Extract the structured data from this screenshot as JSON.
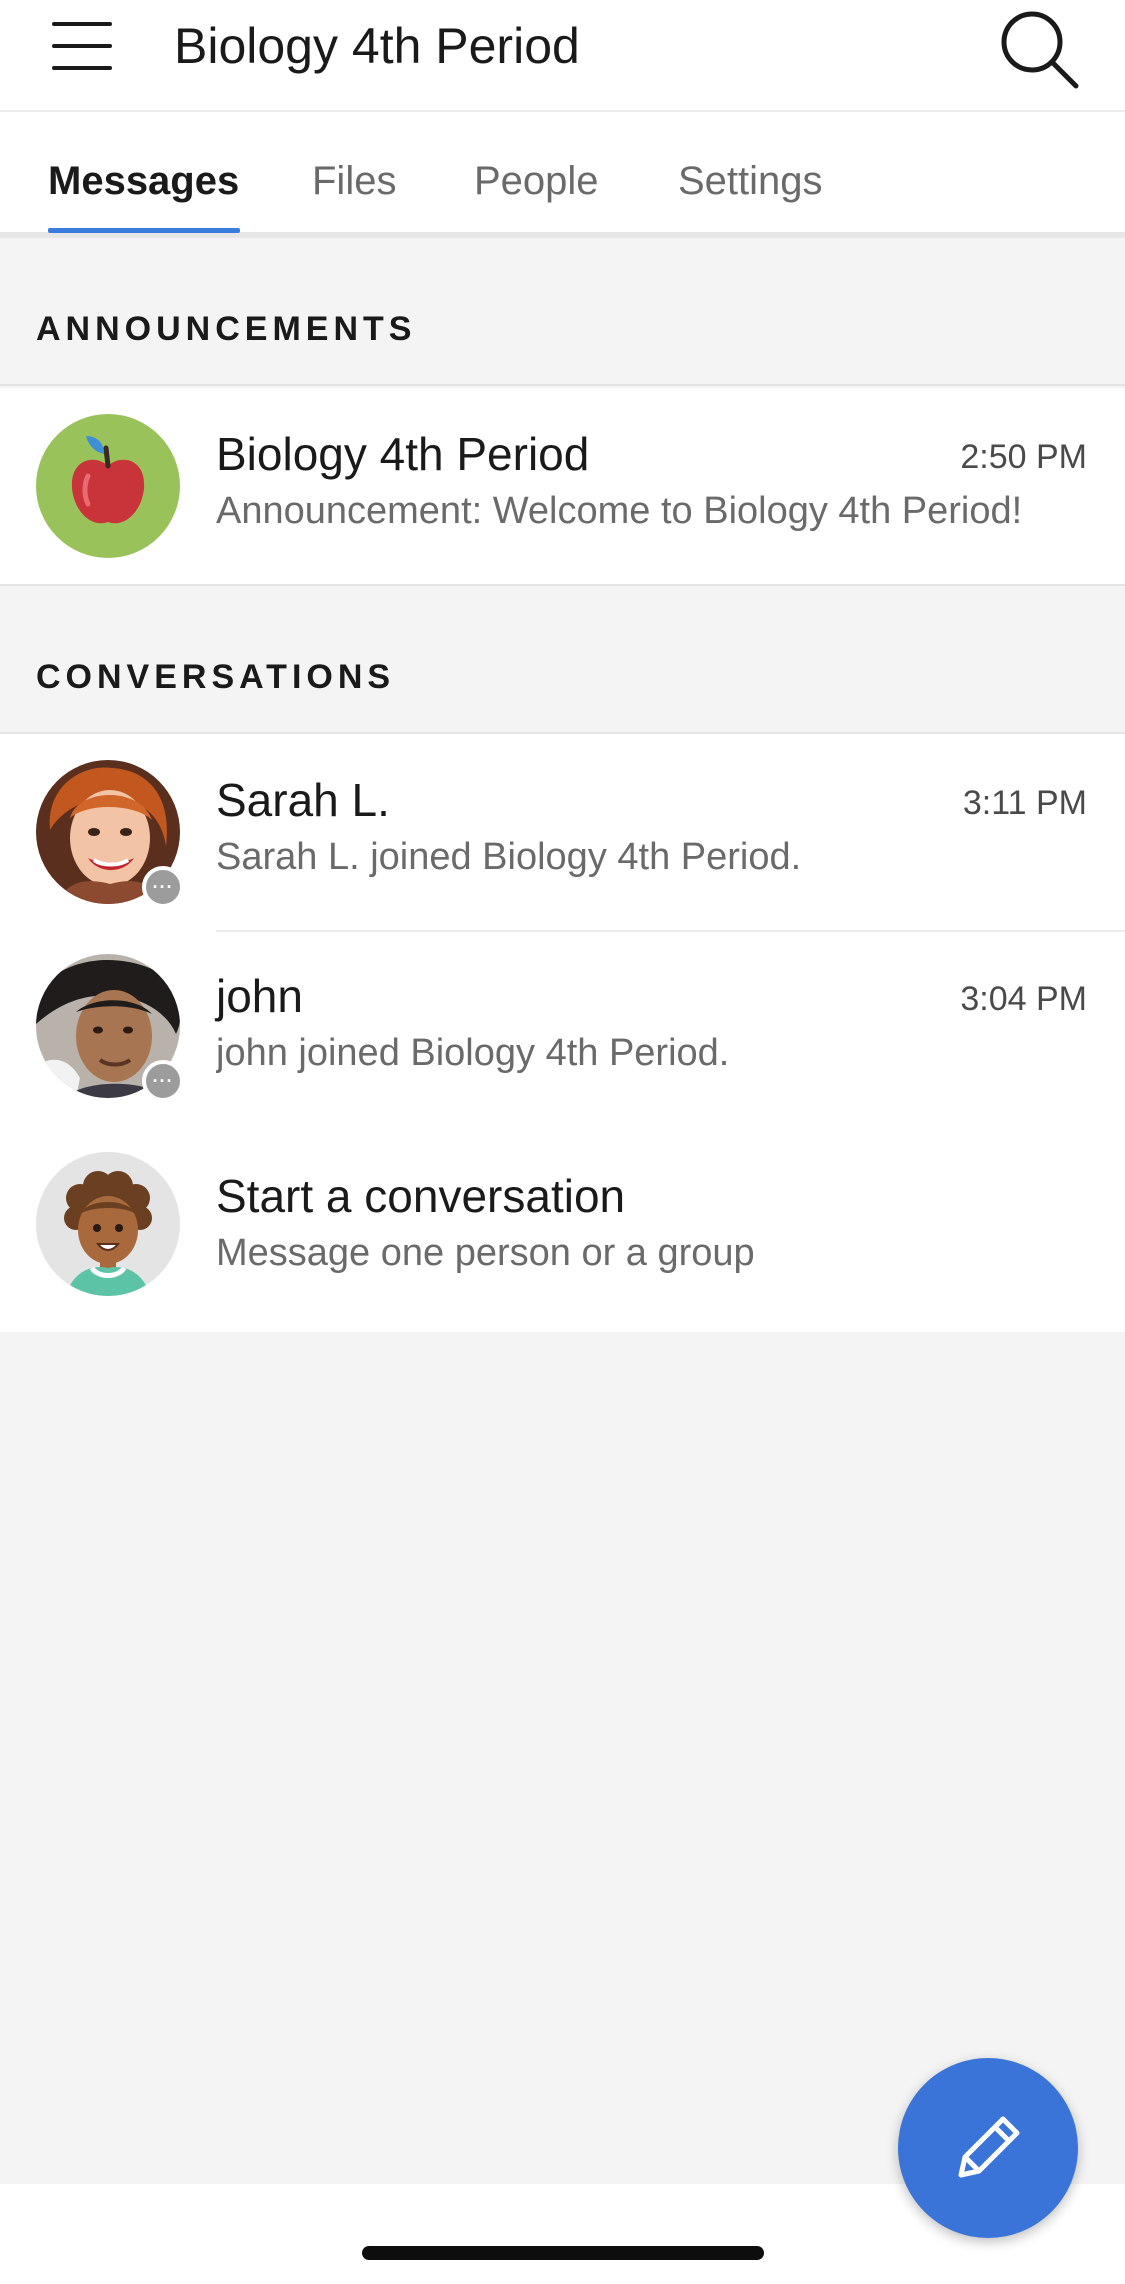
{
  "header": {
    "title": "Biology 4th Period",
    "menu_icon": "hamburger-menu-icon",
    "search_icon": "search-icon"
  },
  "tabs": [
    {
      "label": "Messages",
      "active": true
    },
    {
      "label": "Files",
      "active": false
    },
    {
      "label": "People",
      "active": false
    },
    {
      "label": "Settings",
      "active": false
    }
  ],
  "announcements": {
    "header": "ANNOUNCEMENTS",
    "items": [
      {
        "name": "Biology 4th Period",
        "time": "2:50 PM",
        "preview": "Announcement: Welcome to Biology 4th Period!",
        "avatar": "apple-icon"
      }
    ]
  },
  "conversations": {
    "header": "CONVERSATIONS",
    "items": [
      {
        "name": "Sarah L.",
        "time": "3:11 PM",
        "preview": "Sarah L. joined Biology 4th Period.",
        "avatar": "user-photo"
      },
      {
        "name": "john",
        "time": "3:04 PM",
        "preview": "john joined Biology 4th Period.",
        "avatar": "user-photo"
      }
    ],
    "start": {
      "title": "Start a conversation",
      "subtitle": "Message one person or a group",
      "avatar": "person-illustration-icon"
    }
  },
  "compose": {
    "icon": "pencil-icon"
  },
  "colors": {
    "accent": "#3b7ddd",
    "fab": "#3b74d8",
    "background": "#f4f4f4",
    "apple_avatar_bg": "#9ac25a"
  }
}
